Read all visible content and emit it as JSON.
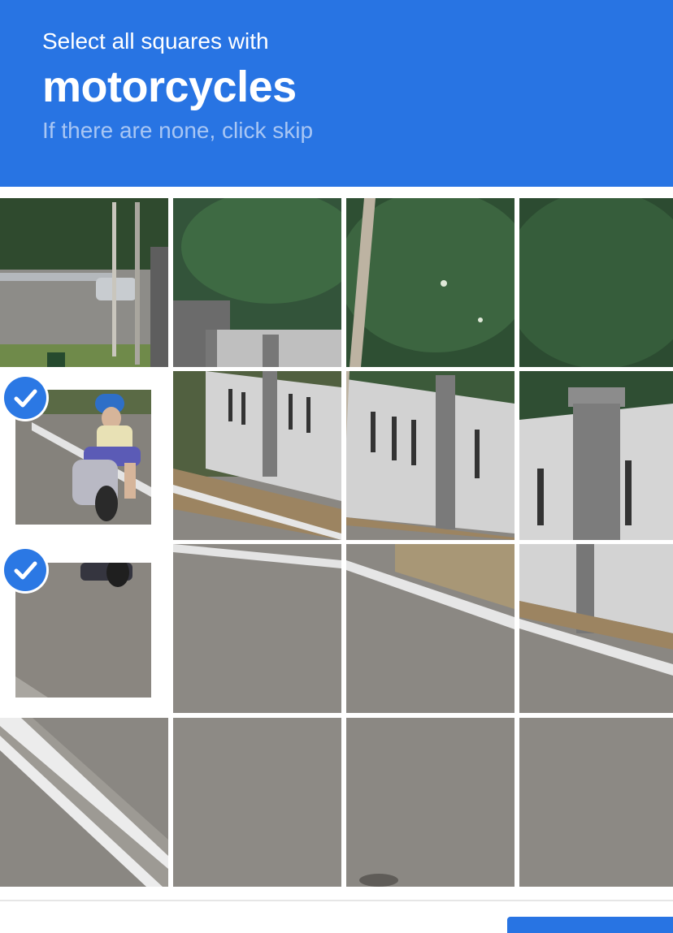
{
  "header": {
    "instruction": "Select all squares with",
    "target": "motorcycles",
    "hint": "If there are none, click skip"
  },
  "grid": {
    "rows": 4,
    "cols": 4,
    "selected_tiles": [
      {
        "row": 2,
        "col": 1,
        "content": "person riding motorcycle"
      },
      {
        "row": 3,
        "col": 1,
        "content": "motorcycle rear wheel on road"
      }
    ]
  },
  "colors": {
    "header_bg": "#2874e3",
    "check_bg": "#2b78e4"
  }
}
